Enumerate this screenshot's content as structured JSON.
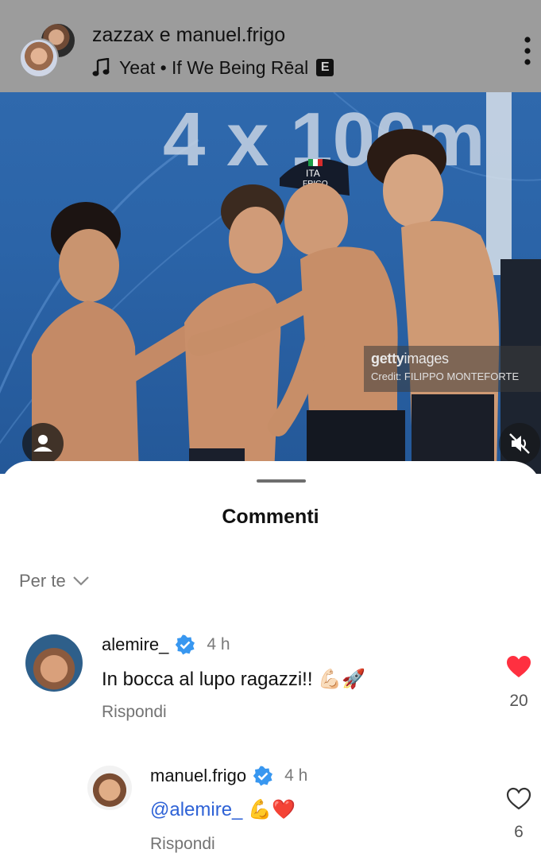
{
  "header": {
    "title": "zazzax e manuel.frigo",
    "music_icon": "music-note-icon",
    "music": "Yeat • If We Being Rēal",
    "explicit_badge": "E",
    "more_icon": "more-vertical-icon"
  },
  "photo": {
    "scoreboard_text": "4 x 100m",
    "cap_text": "ITA",
    "cap_name": "FRIGO",
    "watermark_brand_bold": "getty",
    "watermark_brand_regular": "images",
    "watermark_credit": "Credit: FILIPPO MONTEFORTE",
    "tag_icon": "user-tag-icon",
    "mute_icon": "muted-speaker-icon"
  },
  "sheet": {
    "title": "Commenti",
    "sort_label": "Per te",
    "sort_icon": "chevron-down-icon"
  },
  "comments": [
    {
      "user": "alemire_",
      "verified": true,
      "time": "4 h",
      "text": "In bocca al lupo ragazzi!! 💪🏻🚀",
      "reply_label": "Rispondi",
      "liked": true,
      "likes": "20"
    },
    {
      "user": "manuel.frigo",
      "verified": true,
      "time": "4 h",
      "mention": "@alemire_",
      "text": " 💪❤️",
      "reply_label": "Rispondi",
      "liked": false,
      "likes": "6"
    }
  ],
  "colors": {
    "header_bg": "#9c9c9c",
    "like_red": "#ff3040",
    "verified_blue": "#3897f0",
    "mention_blue": "#2e62d6"
  }
}
